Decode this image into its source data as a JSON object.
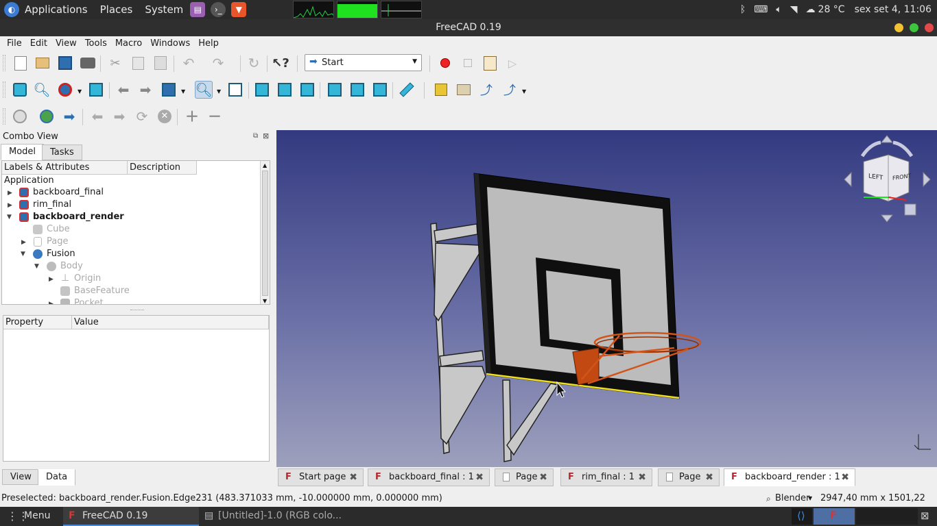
{
  "system_panel": {
    "applications": "Applications",
    "places": "Places",
    "system": "System",
    "weather": "28 °C",
    "clock": "sex set  4, 11:06"
  },
  "window": {
    "title": "FreeCAD 0.19"
  },
  "menubar": [
    "File",
    "Edit",
    "View",
    "Tools",
    "Macro",
    "Windows",
    "Help"
  ],
  "toolbar": {
    "workbench": "Start"
  },
  "combo_view": {
    "title": "Combo View",
    "tabs": [
      "Model",
      "Tasks"
    ],
    "columns": [
      "Labels & Attributes",
      "Description"
    ],
    "tree": [
      {
        "label": "Application"
      },
      {
        "label": "backboard_final"
      },
      {
        "label": "rim_final"
      },
      {
        "label": "backboard_render"
      },
      {
        "label": "Cube"
      },
      {
        "label": "Page"
      },
      {
        "label": "Fusion"
      },
      {
        "label": "Body"
      },
      {
        "label": "Origin"
      },
      {
        "label": "BaseFeature"
      },
      {
        "label": "Pocket"
      }
    ],
    "property_columns": [
      "Property",
      "Value"
    ],
    "bottom_tabs": [
      "View",
      "Data"
    ]
  },
  "navcube": {
    "left": "LEFT",
    "front": "FRONT"
  },
  "doc_tabs": [
    {
      "label": "Start page"
    },
    {
      "label": "backboard_final : 1"
    },
    {
      "label": "Page"
    },
    {
      "label": "rim_final : 1"
    },
    {
      "label": "Page"
    },
    {
      "label": "backboard_render : 1"
    }
  ],
  "status": {
    "preselected": "Preselected: backboard_render.Fusion.Edge231 (483.371033 mm, -10.000000 mm, 0.000000 mm)",
    "nav_style": "Blender",
    "dimensions": "2947,40 mm x 1501,22 mm"
  },
  "taskbar": {
    "menu": "Menu",
    "app1": "FreeCAD 0.19",
    "app2": "[Untitled]-1.0 (RGB colo..."
  },
  "colors": {
    "accent_orange": "#d2541a",
    "view_top": "#333a80",
    "view_bottom": "#9da0bc"
  }
}
